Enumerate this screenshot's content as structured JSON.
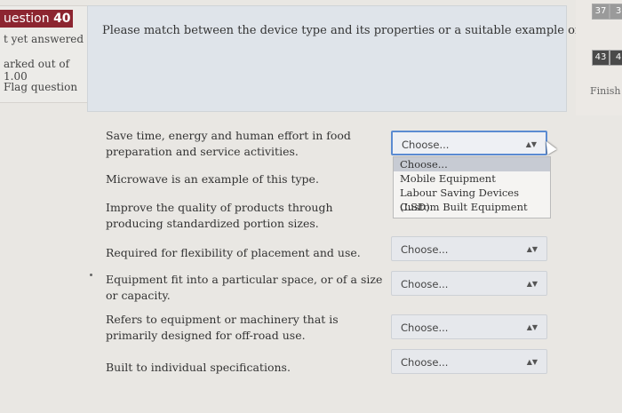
{
  "question_info": {
    "number_label": "uestion",
    "number": "40",
    "state": "t yet answered",
    "marks": "arked out of 1.00",
    "flag": "Flag question"
  },
  "question": {
    "text": "Please match between the device type and its properties or a suitable example of it. K, P, I, T"
  },
  "navigation": {
    "buttons": [
      "37",
      "3",
      "43",
      "4"
    ],
    "finish": "Finish"
  },
  "rows": [
    {
      "prompt": "Save time, energy and human effort in food preparation and service activities.",
      "selected": "Choose..."
    },
    {
      "prompt": "Microwave is an example of this type.",
      "selected": "Choose..."
    },
    {
      "prompt": "Improve the quality of products through producing standardized portion sizes.",
      "selected": "Choose..."
    },
    {
      "prompt": "Required for flexibility of placement and use.",
      "selected": "Choose..."
    },
    {
      "prompt": "Equipment fit into a particular space, or of a size or capacity.",
      "selected": "Choose..."
    },
    {
      "prompt": "Refers to equipment or machinery that is primarily designed for off-road use.",
      "selected": "Choose..."
    },
    {
      "prompt": "Built to individual specifications.",
      "selected": "Choose..."
    }
  ],
  "dropdown": {
    "options": [
      "Choose...",
      "Mobile Equipment",
      "Labour Saving Devices (LSD)",
      "Custom Built Equipment"
    ],
    "highlighted": 0
  },
  "icons": {
    "select_arrow": "up-down-arrow-icon",
    "cursor": "mouse-pointer-icon"
  },
  "colors": {
    "question_badge": "#8c2530",
    "focus_border": "#5b8bd1"
  }
}
